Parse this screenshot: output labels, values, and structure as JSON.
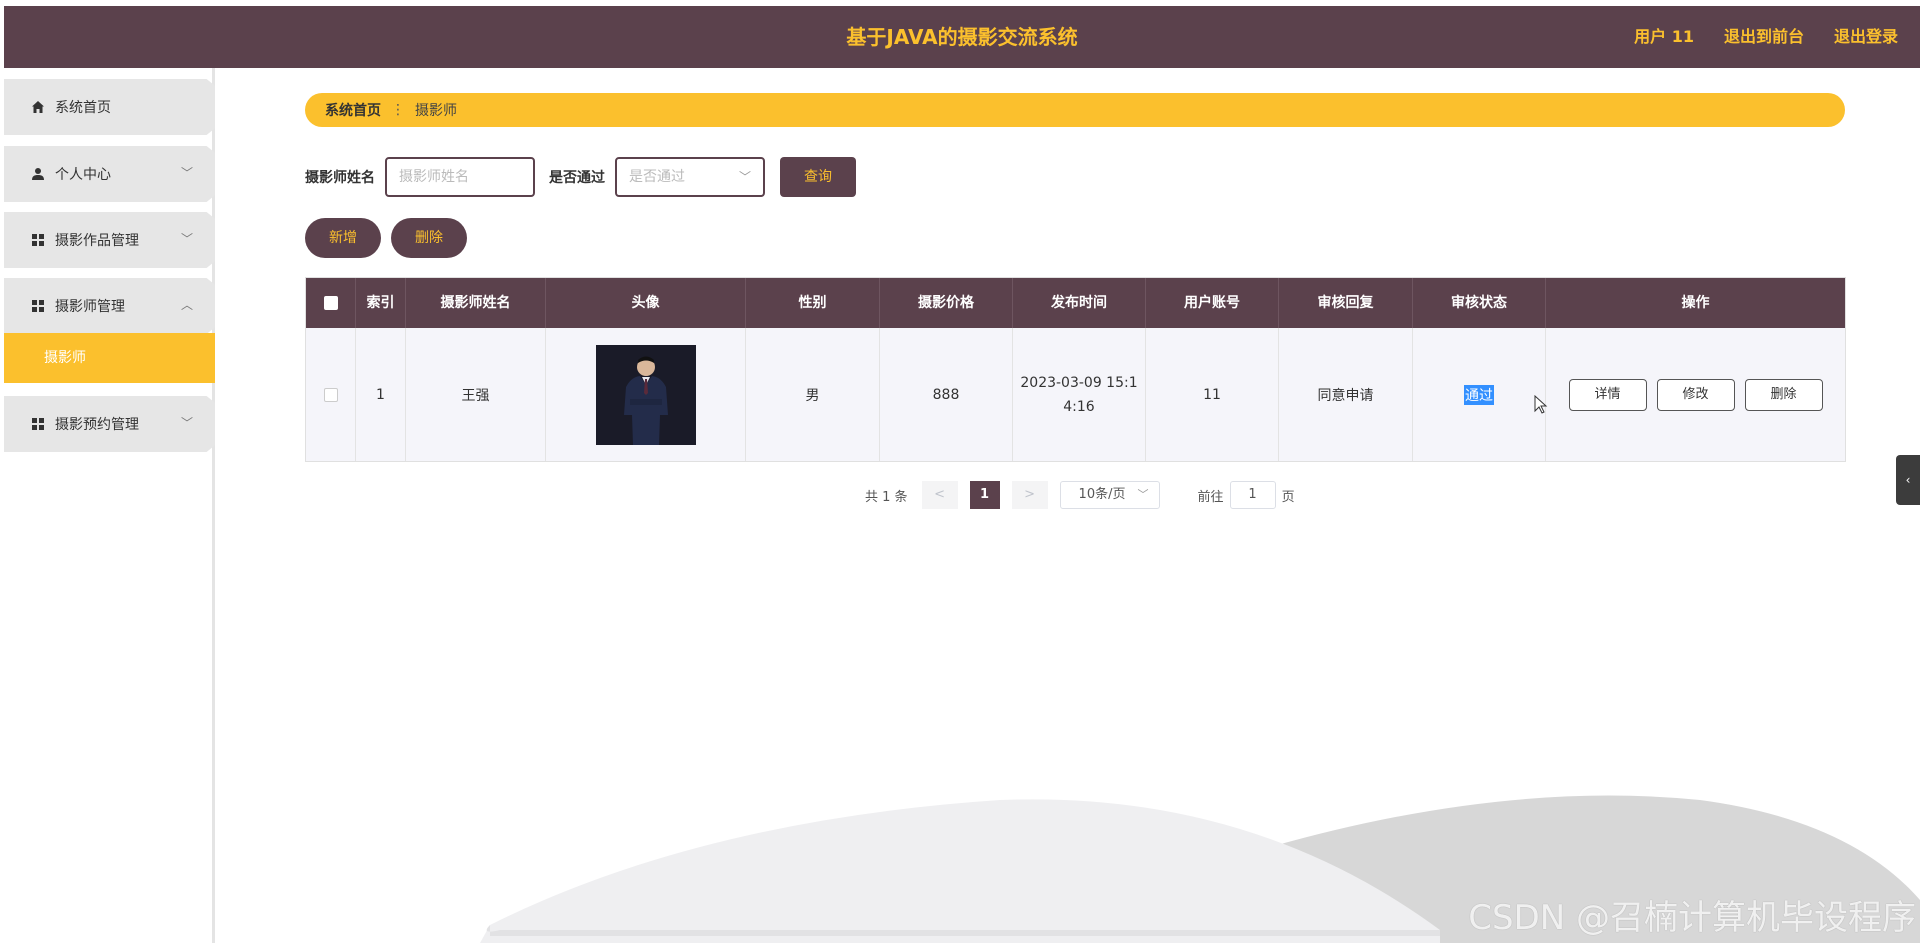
{
  "header": {
    "title": "基于JAVA的摄影交流系统",
    "user_label": "用户 11",
    "front_link": "退出到前台",
    "logout_link": "退出登录"
  },
  "sidebar": {
    "items": [
      {
        "label": "系统首页",
        "icon": "home-icon"
      },
      {
        "label": "个人中心",
        "icon": "user-icon"
      },
      {
        "label": "摄影作品管理",
        "icon": "grid-icon"
      },
      {
        "label": "摄影师管理",
        "icon": "grid-icon"
      },
      {
        "label": "摄影预约管理",
        "icon": "grid-icon"
      }
    ],
    "active_sub": "摄影师"
  },
  "breadcrumb": {
    "home": "系统首页",
    "current": "摄影师"
  },
  "search": {
    "name_label": "摄影师姓名",
    "name_placeholder": "摄影师姓名",
    "pass_label": "是否通过",
    "pass_placeholder": "是否通过",
    "query_button": "查询"
  },
  "actions": {
    "add": "新增",
    "delete": "删除"
  },
  "table": {
    "headers": [
      "索引",
      "摄影师姓名",
      "头像",
      "性别",
      "摄影价格",
      "发布时间",
      "用户账号",
      "审核回复",
      "审核状态",
      "操作"
    ],
    "rows": [
      {
        "index": "1",
        "name": "王强",
        "gender": "男",
        "price": "888",
        "time_line1": "2023-03-09 15:1",
        "time_line2": "4:16",
        "account": "11",
        "reply": "同意申请",
        "status": "通过",
        "ops": [
          "详情",
          "修改",
          "删除"
        ]
      }
    ]
  },
  "pager": {
    "total": "共 1 条",
    "prev": "<",
    "page": "1",
    "next": ">",
    "size": "10条/页",
    "goto_prefix": "前往",
    "goto_value": "1",
    "goto_suffix": "页"
  },
  "watermark": "CSDN @召楠计算机毕设程序",
  "colors": {
    "primary": "#5b414c",
    "accent": "#fbc02d"
  }
}
